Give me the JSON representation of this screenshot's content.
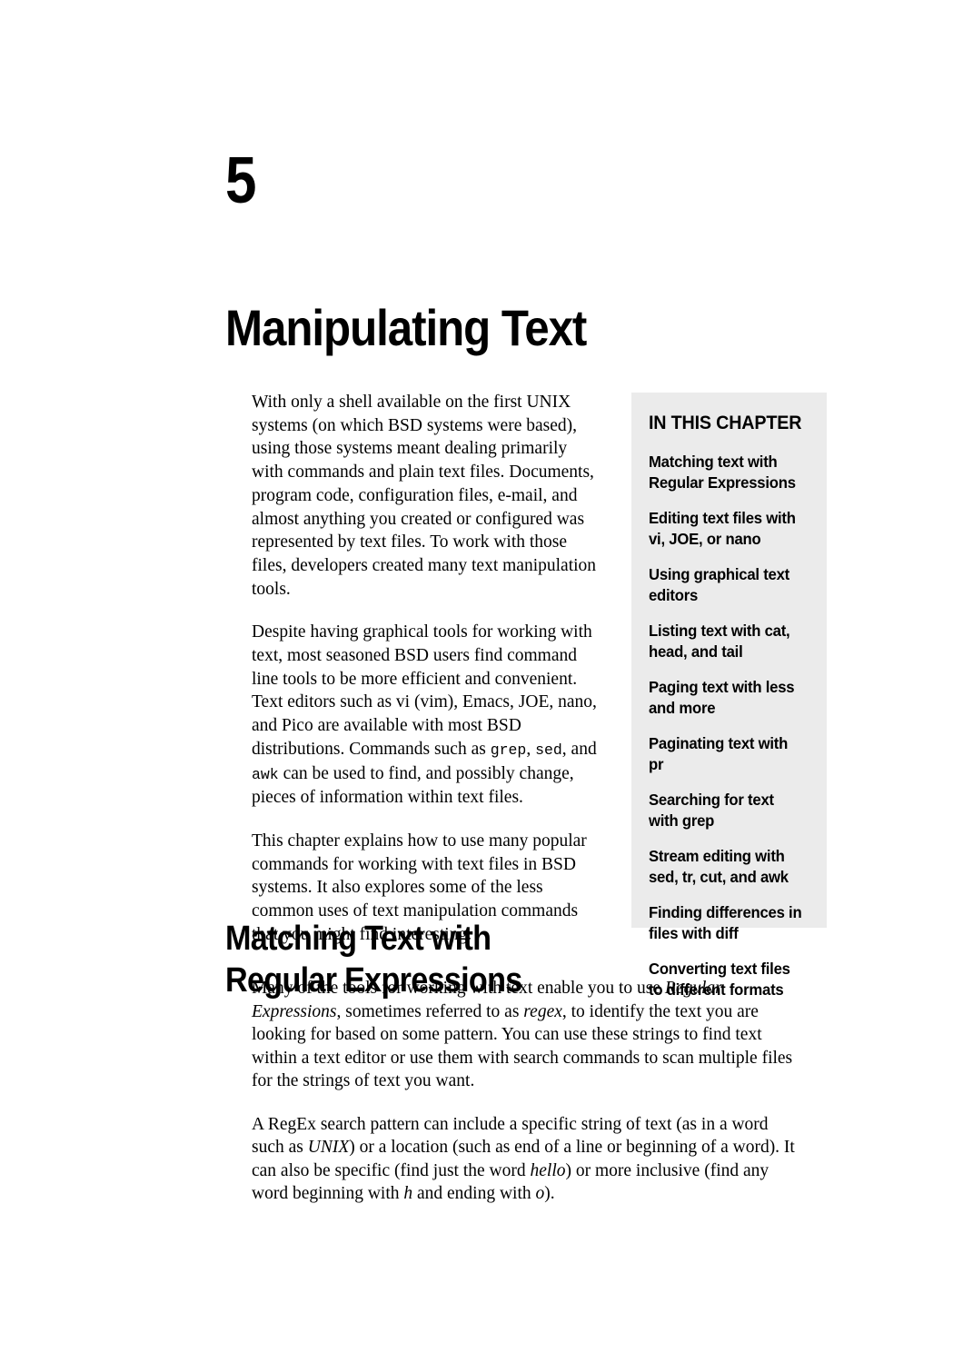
{
  "chapter": {
    "number": "5",
    "title": "Manipulating Text"
  },
  "intro": {
    "paragraph_1": "With only a shell available on the first UNIX systems (on which BSD systems were based), using those systems meant dealing primarily with commands and plain text files. Documents, program code, configuration files, e-mail, and almost anything you created or configured was represented by text files. To work with those files, developers created many text manipulation tools.",
    "paragraph_2_part_1": "Despite having graphical tools for working with text, most seasoned BSD users find command line tools to be more efficient and convenient. Text editors such as vi (vim), Emacs, JOE, nano, and Pico are available with most BSD distributions. Commands such as ",
    "paragraph_2_code_1": "grep",
    "paragraph_2_part_2": ", ",
    "paragraph_2_code_2": "sed",
    "paragraph_2_part_3": ", and ",
    "paragraph_2_code_3": "awk",
    "paragraph_2_part_4": " can be used to find, and possibly change, pieces of information within text files.",
    "paragraph_3": "This chapter explains how to use many popular commands for working with text files in BSD systems. It also explores some of the less common uses of text manipulation commands that you might find interesting."
  },
  "in_this_chapter": {
    "heading": "IN THIS CHAPTER",
    "items": [
      "Matching text with Regular Expressions",
      "Editing text files with vi, JOE, or nano",
      "Using graphical text editors",
      "Listing text with cat, head, and tail",
      "Paging text with less and more",
      "Paginating text with pr",
      "Searching for text with grep",
      "Stream editing with sed, tr, cut, and awk",
      "Finding differences in files with diff",
      "Converting text files to different formats"
    ],
    "background_color": "#ebebeb"
  },
  "section": {
    "heading": "Matching Text with Regular Expressions",
    "paragraph_1_part_1": "Many of the tools for working with text enable you to use ",
    "paragraph_1_italic_1": "Regular Expressions",
    "paragraph_1_part_2": ", sometimes referred to as ",
    "paragraph_1_italic_2": "regex",
    "paragraph_1_part_3": ", to identify the text you are looking for based on some pattern. You can use these strings to find text within a text editor or use them with search commands to scan multiple files for the strings of text you want.",
    "paragraph_2_part_1": "A RegEx search pattern can include a specific string of text (as in a word such as ",
    "paragraph_2_italic_1": "UNIX",
    "paragraph_2_part_2": ") or a location (such as end of a line or beginning of a word). It can also be specific (find just the word ",
    "paragraph_2_italic_2": "hello",
    "paragraph_2_part_3": ") or more inclusive (find any word beginning with ",
    "paragraph_2_italic_3": "h",
    "paragraph_2_part_4": " and ending with ",
    "paragraph_2_italic_4": "o",
    "paragraph_2_part_5": ")."
  }
}
